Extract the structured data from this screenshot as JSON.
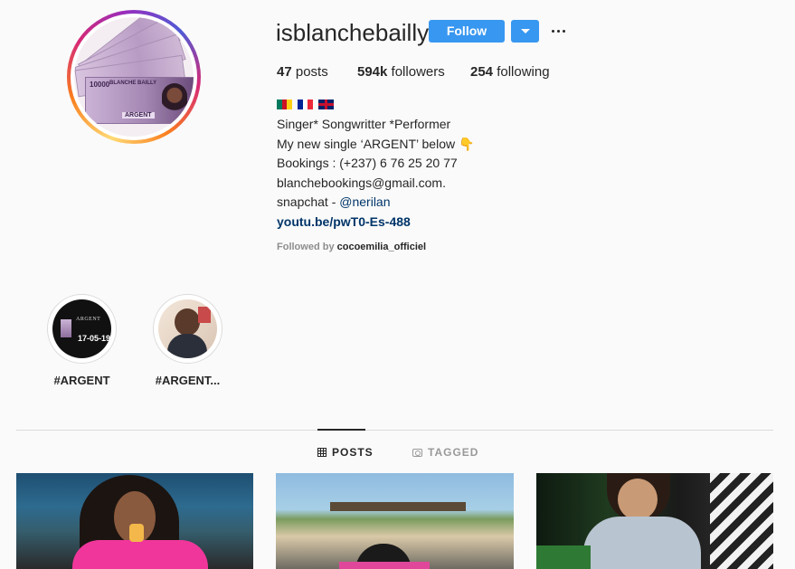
{
  "profile": {
    "username": "isblanchebailly",
    "follow_label": "Follow",
    "avatar_note_text": "10000",
    "avatar_note_caption": "BLANCHE BAILLY",
    "avatar_note_word": "ARGENT"
  },
  "stats": {
    "posts_count": "47",
    "posts_label": "posts",
    "followers_count": "594k",
    "followers_label": "followers",
    "following_count": "254",
    "following_label": "following"
  },
  "bio": {
    "line1": "Singer* Songwritter *Performer",
    "line2": "My new single ‘ARGENT’ below 👇",
    "line3": "Bookings : (+237) 6 76 25 20 77",
    "line4": "blanchebookings@gmail.com.",
    "line5_prefix": "snapchat - ",
    "line5_link": "@nerilan",
    "url": "youtu.be/pwT0-Es-488",
    "followed_by_prefix": "Followed by",
    "followed_by_name": "cocoemilia_officiel"
  },
  "highlights": [
    {
      "label": "#ARGENT",
      "date": "17-05-19",
      "mini_text": "ARGENT"
    },
    {
      "label": "#ARGENT..."
    }
  ],
  "tabs": {
    "posts": "POSTS",
    "tagged": "TAGGED"
  },
  "colors": {
    "accent": "#3897f0",
    "link": "#003569",
    "muted": "#8e8e8e",
    "divider": "#dbdbdb"
  }
}
